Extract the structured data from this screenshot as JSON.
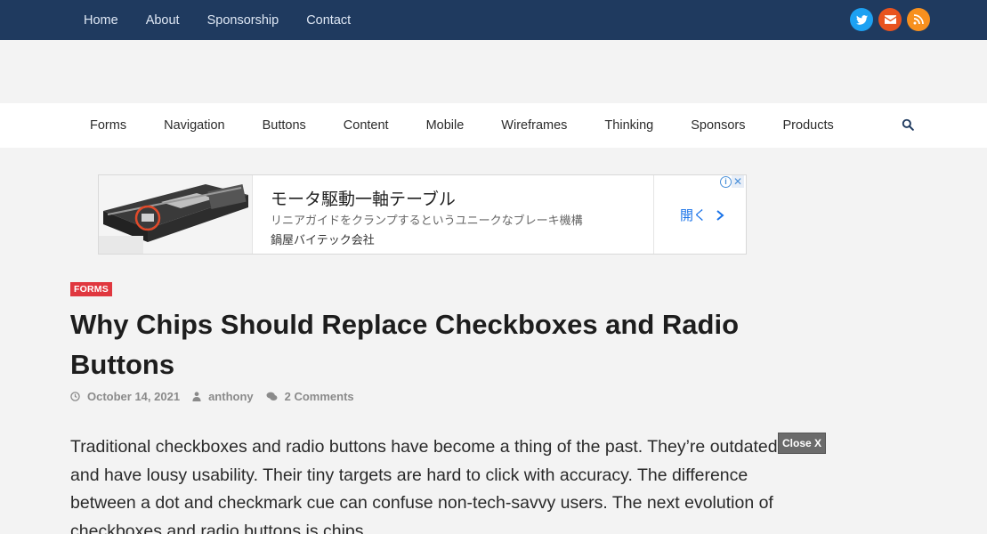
{
  "topnav": {
    "items": [
      "Home",
      "About",
      "Sponsorship",
      "Contact"
    ]
  },
  "social": [
    "twitter-icon",
    "email-icon",
    "rss-icon"
  ],
  "mainnav": {
    "items": [
      "Forms",
      "Navigation",
      "Buttons",
      "Content",
      "Mobile",
      "Wireframes",
      "Thinking",
      "Sponsors",
      "Products"
    ]
  },
  "ad": {
    "title": "モータ駆動一軸テーブル",
    "description": "リニアガイドをクランプするというユニークなブレーキ機構",
    "company": "鍋屋バイテック会社",
    "open_label": "開く"
  },
  "article": {
    "category": "FORMS",
    "title": "Why Chips Should Replace Checkboxes and Radio Buttons",
    "date": "October 14, 2021",
    "author": "anthony",
    "comments": "2 Comments",
    "body": "Traditional checkboxes and radio buttons have become a thing of the past. They’re outdated and have lousy usability. Their tiny targets are hard to click with accuracy. The difference between a dot and checkmark cue can confuse non-tech-savvy users. The next evolution of checkboxes and radio buttons is chips."
  },
  "overlay": {
    "close_label": "Close X"
  },
  "colors": {
    "topbar": "#1f3a5f",
    "category": "#e0373f",
    "ad_link": "#1a73e8"
  }
}
